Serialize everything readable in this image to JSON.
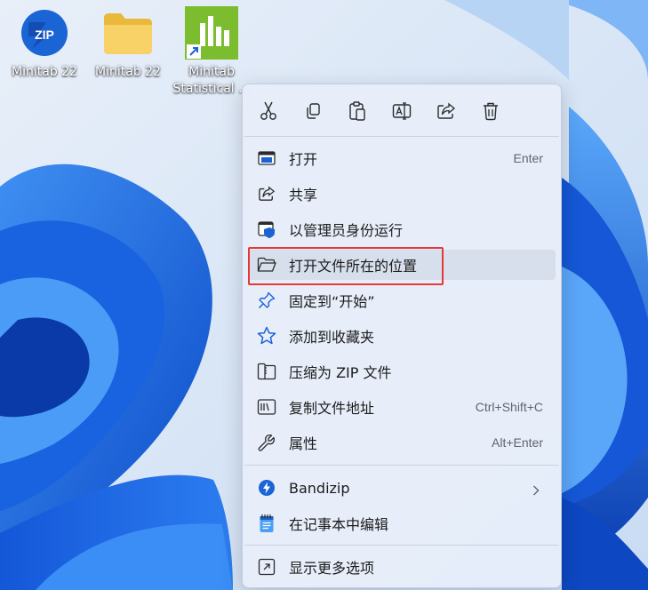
{
  "desktop": {
    "icons": [
      {
        "label": "Minitab 22",
        "icon": "bandizip-zip-icon"
      },
      {
        "label": "Minitab 22",
        "icon": "folder-icon"
      },
      {
        "label_line1": "Minitab",
        "label_line2": "Statistical ...",
        "icon": "minitab-statistical-shortcut-icon"
      }
    ]
  },
  "context_menu": {
    "quick_actions": [
      {
        "name": "cut",
        "icon": "scissors-icon"
      },
      {
        "name": "copy",
        "icon": "copy-icon"
      },
      {
        "name": "paste",
        "icon": "paste-icon"
      },
      {
        "name": "rename",
        "icon": "rename-icon"
      },
      {
        "name": "share",
        "icon": "share-icon"
      },
      {
        "name": "delete",
        "icon": "trash-icon"
      }
    ],
    "items": [
      {
        "label": "打开",
        "shortcut": "Enter",
        "icon": "open-window-icon"
      },
      {
        "label": "共享",
        "shortcut": "",
        "icon": "share-icon"
      },
      {
        "label": "以管理员身份运行",
        "shortcut": "",
        "icon": "shield-admin-icon"
      },
      {
        "label": "打开文件所在的位置",
        "shortcut": "",
        "icon": "folder-open-icon",
        "highlighted": true
      },
      {
        "label": "固定到“开始”",
        "shortcut": "",
        "icon": "pin-icon"
      },
      {
        "label": "添加到收藏夹",
        "shortcut": "",
        "icon": "star-icon"
      },
      {
        "label": "压缩为 ZIP 文件",
        "shortcut": "",
        "icon": "zip-folder-icon"
      },
      {
        "label": "复制文件地址",
        "shortcut": "Ctrl+Shift+C",
        "icon": "copy-path-icon"
      },
      {
        "label": "属性",
        "shortcut": "Alt+Enter",
        "icon": "wrench-icon"
      }
    ],
    "bandizip_item": {
      "label": "Bandizip",
      "icon": "bandizip-icon"
    },
    "notepad_item": {
      "label": "在记事本中编辑",
      "icon": "notepad-icon"
    },
    "more_item": {
      "label": "显示更多选项",
      "icon": "more-options-icon"
    }
  },
  "colors": {
    "highlight_border": "#e53935",
    "accent_blue": "#0a5bd8"
  }
}
